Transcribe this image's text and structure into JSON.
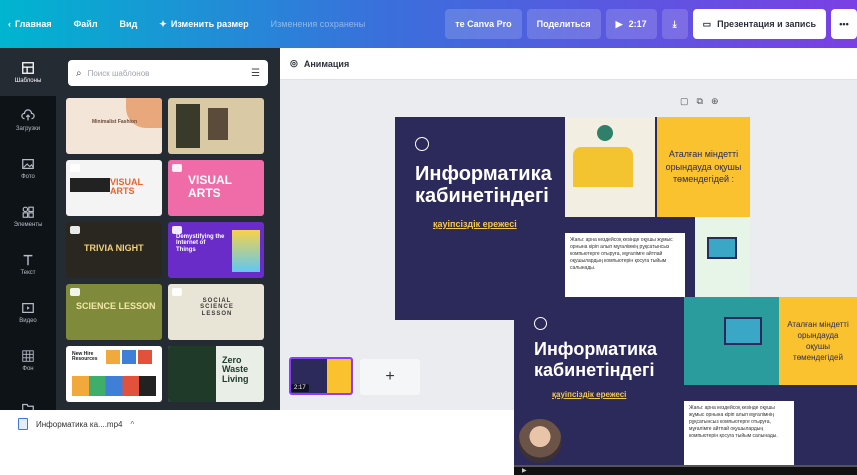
{
  "topbar": {
    "home": "Главная",
    "file": "Файл",
    "view": "Вид",
    "resize": "Изменить размер",
    "saved": "Изменения сохранены",
    "canva_pro": "те Canva Pro",
    "share": "Поделиться",
    "duration": "2:17",
    "present": "Презентация и запись",
    "more": "•••"
  },
  "sidebar": {
    "items": [
      {
        "label": "Шаблоны",
        "icon": "templates-icon"
      },
      {
        "label": "Загрузки",
        "icon": "upload-icon"
      },
      {
        "label": "Фото",
        "icon": "photo-icon"
      },
      {
        "label": "Элементы",
        "icon": "elements-icon"
      },
      {
        "label": "Текст",
        "icon": "text-icon"
      },
      {
        "label": "Видео",
        "icon": "video-icon"
      },
      {
        "label": "Фон",
        "icon": "background-icon"
      },
      {
        "label": "",
        "icon": "folder-icon"
      }
    ]
  },
  "templates": {
    "search_placeholder": "Поиск шаблонов",
    "items": [
      {
        "title": "Minimalist Fashion",
        "bg": "#f3e6d8",
        "fg": "#6b4a3a"
      },
      {
        "title": "",
        "bg": "#d9c9a4",
        "fg": "#ffffff"
      },
      {
        "title": "VISUAL ARTS",
        "bg": "#f4f4f4",
        "fg": "#e8632b"
      },
      {
        "title": "VISUAL ARTS",
        "bg": "#f06ca8",
        "fg": "#ffffff"
      },
      {
        "title": "TRIVIA NIGHT",
        "bg": "#2a2620",
        "fg": "#f2d27a"
      },
      {
        "title": "Demystifying the Internet of Things",
        "bg": "#6a2cc8",
        "fg": "#ffffff"
      },
      {
        "title": "SCIENCE LESSON",
        "bg": "#7f8a3a",
        "fg": "#f4e8a8"
      },
      {
        "title": "SOCIAL SCIENCE LESSON",
        "bg": "#e8e4d6",
        "fg": "#3a3a3a"
      },
      {
        "title": "New Hire Resources",
        "bg": "#ffffff",
        "fg": "#1a1a1a"
      },
      {
        "title": "Zero Waste Living",
        "bg": "#e9efe6",
        "fg": "#1d3a2a"
      }
    ]
  },
  "editor": {
    "animation_label": "Анимация",
    "slide": {
      "title_line1": "Информатика",
      "title_line2": "кабинетіндегі",
      "subtitle": "қауіпсіздік ережесі",
      "yellow_text": "Аталған міндетті орындауда оқушы төмендегідей :",
      "body_text": "Жағы: арна кездейсоқ кезінде оқушы жұмыс орнына кіріп алып мұғалімнің рұқсатынсыз компьютерге отыруға, мұғалімге айтпай оқушылардың компьютерін қосуға тыйым салынады."
    },
    "slide2": {
      "title_line1": "Информатика",
      "title_line2": "кабинетіндегі",
      "subtitle": "қауіпсіздік ережесі",
      "yellow_text": "Аталған міндетті орындауда оқушы төмендегідей"
    },
    "film": {
      "duration": "2:17",
      "add": "+"
    }
  },
  "downloads": {
    "filename": "Информатика ка....mp4",
    "chevron": "^"
  },
  "colors": {
    "slide_bg": "#2c2a5a",
    "accent_yellow": "#f9c22e",
    "brand_purple": "#8b3dff"
  }
}
